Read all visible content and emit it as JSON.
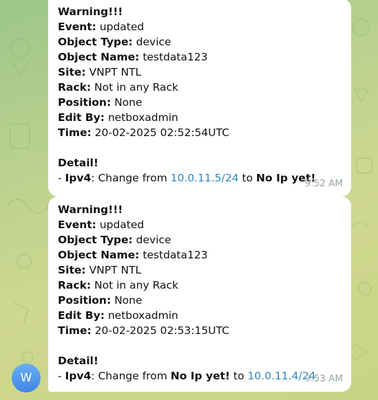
{
  "messages": [
    {
      "line1": "Warning!!!",
      "event_label": "Event:",
      "event_value": " updated",
      "object_type_label": "Object Type:",
      "object_type_value": " device",
      "object_name_label": "Object Name:",
      "object_name_value": " testdata123",
      "site_label": "Site:",
      "site_value": " VNPT NTL",
      "rack_label": "Rack:",
      "rack_value": " Not in any Rack",
      "position_label": "Position:",
      "position_value": " None",
      "edit_by_label": "Edit By:",
      "edit_by_value": " netboxadmin",
      "time_label": "Time:",
      "time_value": " 20-02-2025 02:52:54UTC",
      "detail_label": "Detail!",
      "ipv4_prefix": "- ",
      "ipv4_label": "Ipv4",
      "change_from": ": Change from ",
      "from_value": "10.0.11.5/24",
      "to_text": " to ",
      "to_value": "No Ip yet!",
      "timestamp": "9:52 AM"
    },
    {
      "line1": "Warning!!!",
      "event_label": "Event:",
      "event_value": " updated",
      "object_type_label": "Object Type:",
      "object_type_value": " device",
      "object_name_label": "Object Name:",
      "object_name_value": " testdata123",
      "site_label": "Site:",
      "site_value": " VNPT NTL",
      "rack_label": "Rack:",
      "rack_value": " Not in any Rack",
      "position_label": "Position:",
      "position_value": " None",
      "edit_by_label": "Edit By:",
      "edit_by_value": " netboxadmin",
      "time_label": "Time:",
      "time_value": " 20-02-2025 02:53:15UTC",
      "detail_label": "Detail!",
      "ipv4_prefix": "- ",
      "ipv4_label": "Ipv4",
      "change_from": ": Change from ",
      "from_value": "No Ip yet!",
      "to_text": " to ",
      "to_value": "10.0.11.4/24",
      "timestamp": "9:53 AM"
    }
  ],
  "avatar": {
    "initial": "W"
  },
  "colors": {
    "link": "#2e86c1",
    "bubble": "#ffffff",
    "timestamp": "#9aa6a0",
    "avatar": "#4a90e2"
  },
  "icons": [
    "chat-pattern-background"
  ]
}
